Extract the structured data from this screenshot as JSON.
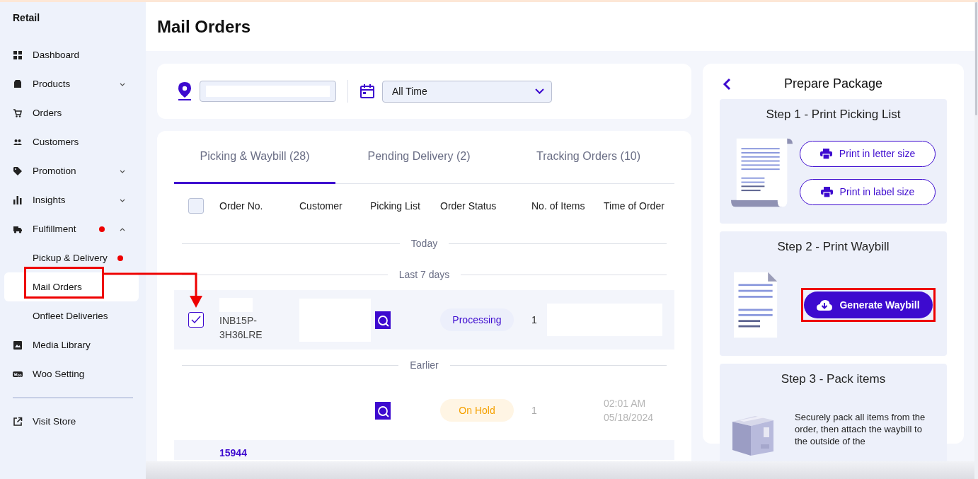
{
  "sidebar": {
    "title": "Retail",
    "items": [
      {
        "label": "Dashboard",
        "selected": false,
        "alert": false
      },
      {
        "label": "Products",
        "selected": false,
        "alert": false,
        "expanded": false
      },
      {
        "label": "Orders",
        "selected": false,
        "alert": false
      },
      {
        "label": "Customers",
        "selected": false,
        "alert": false
      },
      {
        "label": "Promotion",
        "selected": false,
        "alert": false,
        "expanded": false
      },
      {
        "label": "Insights",
        "selected": false,
        "alert": false,
        "expanded": false
      },
      {
        "label": "Fulfillment",
        "selected": false,
        "alert": true,
        "expanded": true,
        "children": [
          {
            "label": "Pickup & Delivery",
            "selected": false,
            "alert": true
          },
          {
            "label": "Mail Orders",
            "selected": true,
            "alert": false
          },
          {
            "label": "Onfleet Deliveries",
            "selected": false,
            "alert": false
          }
        ]
      },
      {
        "label": "Media Library",
        "selected": false,
        "alert": false
      },
      {
        "label": "Woo Setting",
        "selected": false,
        "alert": false
      }
    ],
    "footer_items": [
      {
        "label": "Visit Store"
      }
    ]
  },
  "page_title": "Mail Orders",
  "filters": {
    "date_range": {
      "value": "All Time"
    }
  },
  "tabs": [
    {
      "label": "Picking & Waybill (28)",
      "selected": true
    },
    {
      "label": "Pending Delivery (2)",
      "selected": false
    },
    {
      "label": "Tracking Orders (10)",
      "selected": false
    }
  ],
  "table": {
    "all_checked": false,
    "columns": [
      "Order No.",
      "Customer",
      "Picking List",
      "Order Status",
      "No. of Items",
      "Time of Order"
    ],
    "groups": [
      {
        "label": "Today"
      },
      {
        "label": "Last 7 days",
        "rows": [
          {
            "checked": true,
            "selected": true,
            "disabled": false,
            "order_no": "INB15P-3H36LRE",
            "status": {
              "label": "Processing",
              "kind": "processing"
            },
            "items": "1"
          }
        ]
      },
      {
        "label": "Earlier",
        "rows": [
          {
            "selected": false,
            "disabled": true,
            "status": {
              "label": "On Hold",
              "kind": "on_hold"
            },
            "items": "1",
            "time": "02:01 AM",
            "date": "05/18/2024"
          },
          {
            "selected": true,
            "order_no": "15944",
            "order_link": true
          }
        ]
      }
    ]
  },
  "prepare_package": {
    "title": "Prepare Package",
    "steps": [
      {
        "title": "Step 1 - Print Picking List",
        "kind": "picking",
        "buttons": [
          {
            "label": "Print in letter size",
            "kind": "outline"
          },
          {
            "label": "Print in label size",
            "kind": "outline"
          }
        ]
      },
      {
        "title": "Step 2 - Print Waybill",
        "kind": "waybill",
        "buttons": [
          {
            "label": "Generate Waybill",
            "kind": "primary"
          }
        ]
      },
      {
        "title": "Step 3 - Pack items",
        "kind": "pack",
        "text": "Securely pack all items from the order, then attach the waybill to the outside of the"
      }
    ]
  }
}
